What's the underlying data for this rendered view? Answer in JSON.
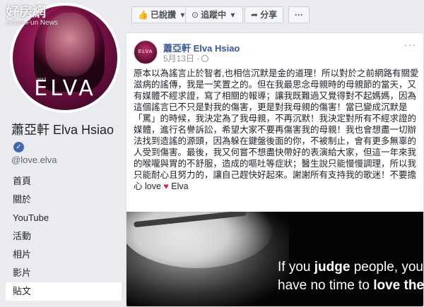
{
  "page": {
    "name": "蕭亞軒 Elva Hsiao",
    "handle": "@love.elva",
    "profile_logo": "ELVA",
    "profile_year": "2017"
  },
  "actions": {
    "liked_label": "已說讚",
    "following_label": "追蹤中",
    "share_label": "分享",
    "more_label": "···"
  },
  "nav": [
    {
      "label": "首頁"
    },
    {
      "label": "關於"
    },
    {
      "label": "YouTube"
    },
    {
      "label": "活動"
    },
    {
      "label": "相片"
    },
    {
      "label": "影片"
    },
    {
      "label": "貼文"
    }
  ],
  "post": {
    "author": "蕭亞軒 Elva Hsiao",
    "date": "5月13日 ·",
    "more": "···",
    "text_main": "原本以為謠言止於智者,也相信沉默是金的道理！所以對於之前網路有關愛滋病的謠傳，我是一笑置之的。但在我最思念母親時的母親節的當天，又有媒體不經求證，寫了相關的報導；讓我既難過又覺得對不起媽媽，因為這個謠言已不只是對我的傷害，更是對我母親的傷害！當已變成沉默是「罵」的時候，我決定為了我母親，不再沉默！我決定對所有不經求證的媒體，進行名譽訴訟，希望大家不要再傷害我的母親！我也會想盡一切辦法找到造謠的源頭，因為躲在鍵盤後面的你，不被制止，會有更多無辜的人受到傷害。最後，我又何嘗不想盡快帶好的表演給大家，但這一年來我的喉嚨與胃的不舒服，造成的嘔吐等症狀；醫生說只能慢慢調理，所以我只能耐心且努力的，讓自己趕快好起來。謝謝所有支持我的歌迷！不要擔心 love",
    "heart": "♥",
    "sign": "Elva",
    "image_quote_line1_pre": "If you ",
    "image_quote_line1_bold": "judge",
    "image_quote_line1_post": " people, you",
    "image_quote_line2_pre": "have no time to ",
    "image_quote_line2_bold": "love them."
  },
  "watermark": {
    "main": "好房網",
    "sub": "HouseFun News"
  }
}
